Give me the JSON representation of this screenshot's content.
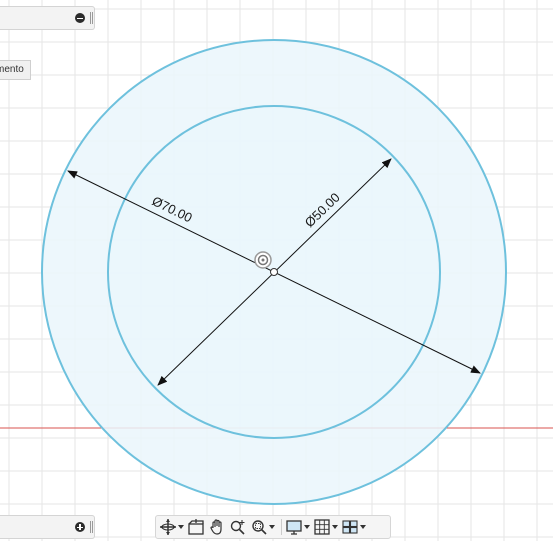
{
  "sketch": {
    "outer_diameter_label": "Ø70.00",
    "inner_diameter_label": "Ø50.00"
  },
  "left_panel": {
    "partial_label": "mento"
  },
  "colors": {
    "circle_stroke": "#6ec1dd",
    "profile_fill": "#eaf6fc",
    "grid_line": "#e6e6e6",
    "x_axis": "#d9534f",
    "dimension_line": "#111111"
  },
  "navigation_toolbar": {
    "items": [
      "orbit-icon",
      "look-at-icon",
      "pan-icon",
      "zoom-icon",
      "fit-icon",
      "display-settings-icon",
      "grid-settings-icon",
      "viewports-icon"
    ]
  }
}
